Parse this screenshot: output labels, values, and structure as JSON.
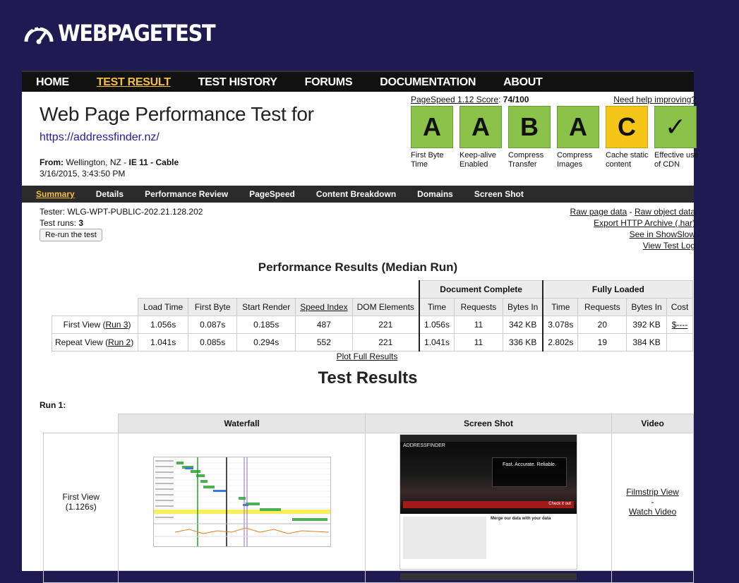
{
  "logo": {
    "text": "WEBPAGETEST",
    "icon": "speedometer-icon"
  },
  "topnav": [
    "HOME",
    "TEST RESULT",
    "TEST HISTORY",
    "FORUMS",
    "DOCUMENTATION",
    "ABOUT"
  ],
  "header": {
    "title": "Web Page Performance Test for",
    "url": "https://addressfinder.nz/",
    "from_label": "From:",
    "from_location": "Wellington, NZ - ",
    "from_browser": "IE 11 - Cable",
    "date": "3/16/2015, 3:43:50 PM"
  },
  "pagespeed": {
    "label": "PageSpeed 1.12 Score",
    "score": "74/100",
    "help": "Need help improving?",
    "grades": [
      {
        "grade": "A",
        "label": "First Byte Time",
        "color": "#8bc34a"
      },
      {
        "grade": "A",
        "label": "Keep-alive Enabled",
        "color": "#8bc34a"
      },
      {
        "grade": "B",
        "label": "Compress Transfer",
        "color": "#8bc34a"
      },
      {
        "grade": "A",
        "label": "Compress Images",
        "color": "#8bc34a"
      },
      {
        "grade": "C",
        "label": "Cache static content",
        "color": "#f5c518"
      },
      {
        "grade": "✓",
        "label": "Effective use of CDN",
        "color": "#8bc34a"
      }
    ]
  },
  "subnav": [
    "Summary",
    "Details",
    "Performance Review",
    "PageSpeed",
    "Content Breakdown",
    "Domains",
    "Screen Shot"
  ],
  "tester": {
    "line1": "Tester: WLG-WPT-PUBLIC-202.21.128.202",
    "runs_label": "Test runs: ",
    "runs": "3",
    "rerun": "Re-run the test"
  },
  "raw_links": {
    "raw_page": "Raw page data",
    "sep": " - ",
    "raw_object": "Raw object data",
    "har": "Export HTTP Archive (.har)",
    "showslow": "See in ShowSlow",
    "log": "View Test Log"
  },
  "perf": {
    "heading": "Performance Results (Median Run)",
    "group_doc": "Document Complete",
    "group_full": "Fully Loaded",
    "headers": [
      "Load Time",
      "First Byte",
      "Start Render",
      "Speed Index",
      "DOM Elements",
      "Time",
      "Requests",
      "Bytes In",
      "Time",
      "Requests",
      "Bytes In",
      "Cost"
    ],
    "rows": [
      {
        "label": "First View (",
        "run": "Run 3",
        "close": ")",
        "values": [
          "1.056s",
          "0.087s",
          "0.185s",
          "487",
          "221",
          "1.056s",
          "11",
          "342 KB",
          "3.078s",
          "20",
          "392 KB"
        ],
        "cost": "$----"
      },
      {
        "label": "Repeat View (",
        "run": "Run 2",
        "close": ")",
        "values": [
          "1.041s",
          "0.085s",
          "0.294s",
          "552",
          "221",
          "1.041s",
          "11",
          "336 KB",
          "2.802s",
          "19",
          "384 KB"
        ],
        "cost": ""
      }
    ],
    "plot": "Plot Full Results"
  },
  "results": {
    "heading": "Test Results",
    "run": "Run 1:",
    "cols": [
      "Waterfall",
      "Screen Shot",
      "Video"
    ],
    "first_view": "First View",
    "first_view_time": "(1.126s)",
    "filmstrip": "Filmstrip View",
    "dash": "-",
    "watch": "Watch Video"
  },
  "screenshot": {
    "brand": "ADDRESSFINDER",
    "tagline": "Fast. Accurate. Reliable.",
    "merge": "Merge our data with your data",
    "check": "Check it out"
  }
}
